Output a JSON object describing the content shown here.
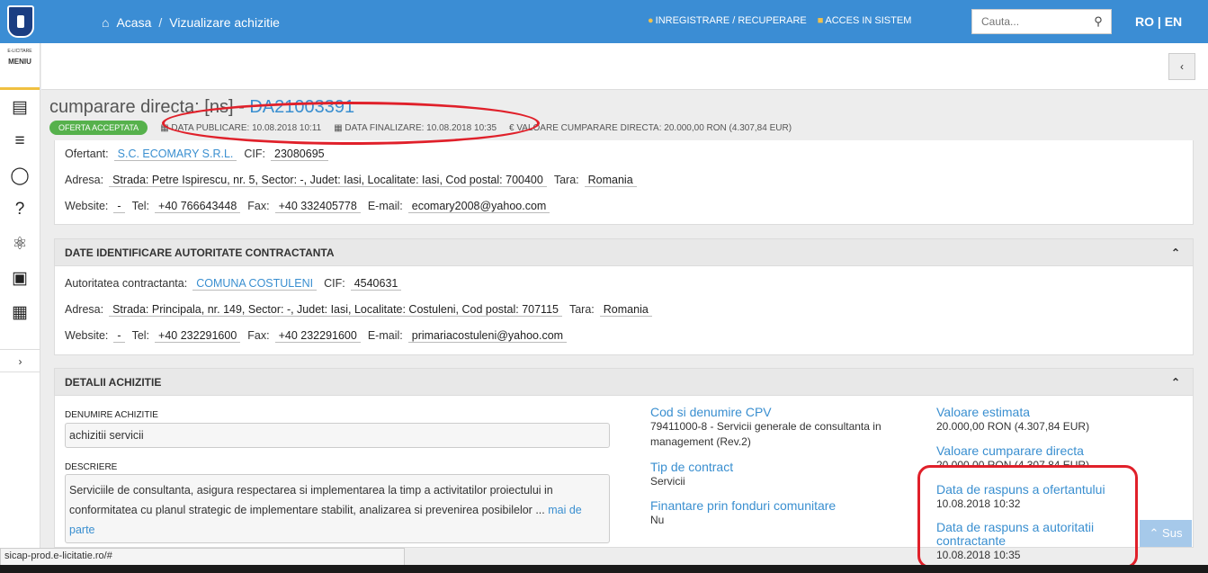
{
  "header": {
    "home_label": "Acasa",
    "crumb_sep": "/",
    "page_label": "Vizualizare achizitie",
    "register_label": "INREGISTRARE / RECUPERARE",
    "login_label": "ACCES IN SISTEM",
    "search_placeholder": "Cauta...",
    "lang": "RO | EN"
  },
  "sidebar": {
    "brand": "E-LICITARE",
    "menu_label": "MENIU"
  },
  "title": {
    "prefix": "cumparare directa: [ns] -",
    "code": "DA21003391"
  },
  "meta": {
    "status_badge": "OFERTA ACCEPTATA",
    "publish": "DATA PUBLICARE: 10.08.2018 10:11",
    "finalize": "DATA FINALIZARE: 10.08.2018 10:35",
    "value": "€ VALOARE CUMPARARE DIRECTA: 20.000,00  RON (4.307,84  EUR)"
  },
  "ofertant": {
    "label": "Ofertant:",
    "name": "S.C. ECOMARY S.R.L.",
    "cif_label": "CIF:",
    "cif": "23080695",
    "addr_label": "Adresa:",
    "addr": "Strada: Petre Ispirescu, nr. 5, Sector: -, Judet: Iasi, Localitate: Iasi, Cod postal: 700400",
    "tara_label": "Tara:",
    "tara": "Romania",
    "web_label": "Website:",
    "web": "-",
    "tel_label": "Tel:",
    "tel": "+40 766643448",
    "fax_label": "Fax:",
    "fax": "+40 332405778",
    "email_label": "E-mail:",
    "email": "ecomary2008@yahoo.com"
  },
  "autoritate": {
    "heading": "DATE IDENTIFICARE AUTORITATE CONTRACTANTA",
    "label": "Autoritatea contractanta:",
    "name": "COMUNA COSTULENI",
    "cif_label": "CIF:",
    "cif": "4540631",
    "addr_label": "Adresa:",
    "addr": "Strada: Principala, nr. 149, Sector: -, Judet: Iasi, Localitate: Costuleni, Cod postal: 707115",
    "tara_label": "Tara:",
    "tara": "Romania",
    "web_label": "Website:",
    "web": "-",
    "tel_label": "Tel:",
    "tel": "+40 232291600",
    "fax_label": "Fax:",
    "fax": "+40 232291600",
    "email_label": "E-mail:",
    "email": "primariacostuleni@yahoo.com"
  },
  "detalii": {
    "heading": "DETALII ACHIZITIE",
    "denumire_label": "DENUMIRE ACHIZITIE",
    "denumire": "achizitii servicii",
    "descriere_label": "DESCRIERE",
    "descriere": "Serviciile de consultanta, asigura respectarea si implementarea la timp a activitatilor proiectului in conformitatea cu planul strategic de implementare stabilit, analizarea si prevenirea posibilelor ...",
    "mai_de_parte": "mai de parte",
    "cpv_h": "Cod si denumire CPV",
    "cpv_v": "79411000-8 - Servicii generale de consultanta in management (Rev.2)",
    "tip_h": "Tip de contract",
    "tip_v": "Servicii",
    "fin_h": "Finantare prin fonduri comunitare",
    "fin_v": "Nu",
    "est_h": "Valoare estimata",
    "est_v": "20.000,00  RON (4.307,84  EUR)",
    "vcd_h": "Valoare cumparare directa",
    "vcd_v": "20.000,00  RON (4.307,84  EUR)",
    "rof_h": "Data de raspuns a ofertantului",
    "rof_v": "10.08.2018 10:32",
    "rau_h": "Data de raspuns a autoritatii contractante",
    "rau_v": "10.08.2018 10:35"
  },
  "sus_label": "Sus",
  "statusbar": "sicap-prod.e-licitatie.ro/#",
  "colors": {
    "brand_blue": "#3b8dd4",
    "link": "#3a8fd0",
    "badge_green": "#56b14c",
    "annotation_red": "#e0202a"
  }
}
